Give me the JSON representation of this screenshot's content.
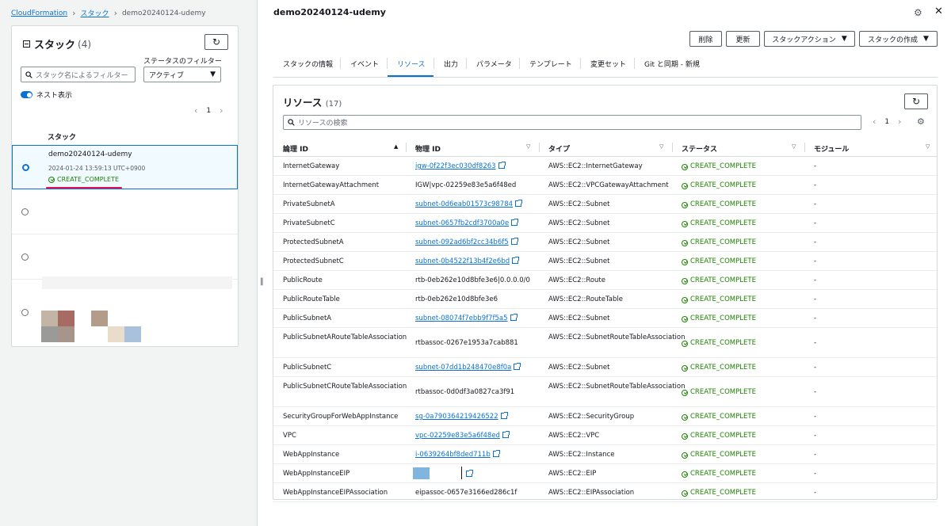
{
  "breadcrumb": {
    "root": "CloudFormation",
    "section": "スタック",
    "current": "demo20240124-udemy"
  },
  "stack_panel": {
    "title": "スタック",
    "count": "(4)",
    "filter_label": "ステータスのフィルター",
    "search_placeholder": "スタック名によるフィルター",
    "status_filter_value": "アクティブ",
    "nested_toggle_label": "ネスト表示",
    "page": "1",
    "column_header": "スタック",
    "selected_stack": {
      "name": "demo20240124-udemy",
      "created": "2024-01-24 13:59:13 UTC+0900",
      "status": "CREATE_COMPLETE"
    }
  },
  "main": {
    "title": "demo20240124-udemy",
    "buttons": {
      "delete": "削除",
      "update": "更新",
      "stack_actions": "スタックアクション",
      "create_stack": "スタックの作成"
    },
    "tabs": [
      "スタックの情報",
      "イベント",
      "リソース",
      "出力",
      "パラメータ",
      "テンプレート",
      "変更セット",
      "Git と同期 - 新規"
    ],
    "active_tab": "リソース"
  },
  "resources": {
    "title": "リソース",
    "count": "(17)",
    "search_placeholder": "リソースの検索",
    "page": "1",
    "columns": [
      "論理 ID",
      "物理 ID",
      "タイプ",
      "ステータス",
      "モジュール"
    ],
    "rows": [
      {
        "logical": "InternetGateway",
        "physical": "igw-0f22f3ec030df8263",
        "link": true,
        "type": "AWS::EC2::InternetGateway",
        "status": "CREATE_COMPLETE",
        "module": "-"
      },
      {
        "logical": "InternetGatewayAttachment",
        "physical": "IGW|vpc-02259e83e5a6f48ed",
        "link": false,
        "type": "AWS::EC2::VPCGatewayAttachment",
        "status": "CREATE_COMPLETE",
        "module": "-"
      },
      {
        "logical": "PrivateSubnetA",
        "physical": "subnet-0d6eab01573c98784",
        "link": true,
        "type": "AWS::EC2::Subnet",
        "status": "CREATE_COMPLETE",
        "module": "-"
      },
      {
        "logical": "PrivateSubnetC",
        "physical": "subnet-0657fb2cdf3700a0e",
        "link": true,
        "type": "AWS::EC2::Subnet",
        "status": "CREATE_COMPLETE",
        "module": "-"
      },
      {
        "logical": "ProtectedSubnetA",
        "physical": "subnet-092ad6bf2cc34b6f5",
        "link": true,
        "type": "AWS::EC2::Subnet",
        "status": "CREATE_COMPLETE",
        "module": "-"
      },
      {
        "logical": "ProtectedSubnetC",
        "physical": "subnet-0b4522f13b4f2e6bd",
        "link": true,
        "type": "AWS::EC2::Subnet",
        "status": "CREATE_COMPLETE",
        "module": "-"
      },
      {
        "logical": "PublicRoute",
        "physical": "rtb-0eb262e10d8bfe3e6|0.0.0.0/0",
        "link": false,
        "type": "AWS::EC2::Route",
        "status": "CREATE_COMPLETE",
        "module": "-"
      },
      {
        "logical": "PublicRouteTable",
        "physical": "rtb-0eb262e10d8bfe3e6",
        "link": false,
        "type": "AWS::EC2::RouteTable",
        "status": "CREATE_COMPLETE",
        "module": "-"
      },
      {
        "logical": "PublicSubnetA",
        "physical": "subnet-08074f7ebb9f7f5a5",
        "link": true,
        "type": "AWS::EC2::Subnet",
        "status": "CREATE_COMPLETE",
        "module": "-"
      },
      {
        "logical": "PublicSubnetARouteTableAssociation",
        "physical": "rtbassoc-0267e1953a7cab881",
        "link": false,
        "type": "AWS::EC2::SubnetRouteTableAssociation",
        "status": "CREATE_COMPLETE",
        "module": "-"
      },
      {
        "logical": "PublicSubnetC",
        "physical": "subnet-07dd1b248470e8f0a",
        "link": true,
        "type": "AWS::EC2::Subnet",
        "status": "CREATE_COMPLETE",
        "module": "-"
      },
      {
        "logical": "PublicSubnetCRouteTableAssociation",
        "physical": "rtbassoc-0d0df3a0827ca3f91",
        "link": false,
        "type": "AWS::EC2::SubnetRouteTableAssociation",
        "status": "CREATE_COMPLETE",
        "module": "-"
      },
      {
        "logical": "SecurityGroupForWebAppInstance",
        "physical": "sg-0a790364219426522",
        "link": true,
        "type": "AWS::EC2::SecurityGroup",
        "status": "CREATE_COMPLETE",
        "module": "-"
      },
      {
        "logical": "VPC",
        "physical": "vpc-02259e83e5a6f48ed",
        "link": true,
        "type": "AWS::EC2::VPC",
        "status": "CREATE_COMPLETE",
        "module": "-"
      },
      {
        "logical": "WebAppInstance",
        "physical": "i-0639264bf8ded711b",
        "link": true,
        "type": "AWS::EC2::Instance",
        "status": "CREATE_COMPLETE",
        "module": "-"
      },
      {
        "logical": "WebAppInstanceEIP",
        "physical": "",
        "link": true,
        "type": "AWS::EC2::EIP",
        "status": "CREATE_COMPLETE",
        "module": "-"
      },
      {
        "logical": "WebAppInstanceEIPAssociation",
        "physical": "eipassoc-0657e3166ed286c1f",
        "link": false,
        "type": "AWS::EC2::EIPAssociation",
        "status": "CREATE_COMPLETE",
        "module": "-"
      }
    ]
  },
  "colors": {
    "accent": "#0972d3",
    "success": "#1d8102",
    "highlight": "#e0115f"
  },
  "icons": [
    "chevron-right-icon",
    "collapse-icon",
    "refresh-icon",
    "search-icon",
    "caret-down-icon",
    "toggle-icon",
    "check-circle-icon",
    "external-link-icon",
    "gear-icon",
    "close-icon",
    "sort-asc-icon",
    "sort-desc-icon",
    "resize-handle-icon"
  ]
}
